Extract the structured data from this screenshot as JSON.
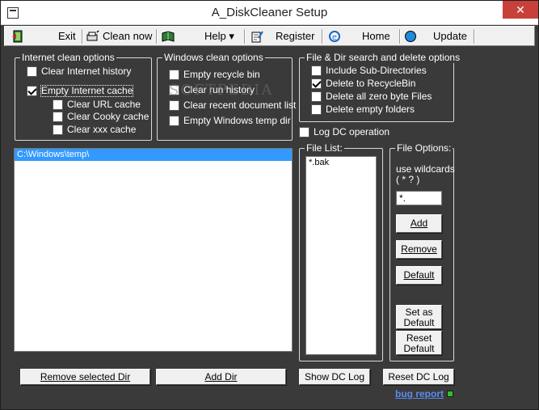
{
  "window": {
    "title": "A_DiskCleaner Setup",
    "close_glyph": "✕"
  },
  "menu": {
    "exit": "Exit",
    "clean_now": "Clean now",
    "help": "Help",
    "help_arrow": "▾",
    "register": "Register",
    "home": "Home",
    "update": "Update"
  },
  "internet": {
    "title": "Internet clean options",
    "clear_history": "Clear Internet history",
    "empty_cache": "Empty Internet cache",
    "clear_url": "Clear URL cache",
    "clear_cooky": "Clear Cooky cache",
    "clear_xxx": "Clear xxx cache"
  },
  "windows": {
    "title": "Windows clean options",
    "empty_recycle": "Empty recycle bin",
    "clear_run": "Clear run history",
    "clear_recent": "Clear recent document list",
    "empty_temp": "Empty Windows temp dir"
  },
  "filedir": {
    "title": "File & Dir search and delete options",
    "include_sub": "Include Sub-Directories",
    "delete_recycle": "Delete to RecycleBin",
    "delete_zero": "Delete all zero byte Files",
    "delete_empty": "Delete empty folders"
  },
  "log_dc": "Log DC operation",
  "dirs": [
    "C:\\Windows\\temp\\"
  ],
  "file_list": {
    "title": "File List:",
    "items": [
      "*.bak"
    ]
  },
  "file_options": {
    "title": "File Options:",
    "wildcard_line1": "use wildcards",
    "wildcard_line2": "( * ? )",
    "input_value": "*.",
    "add": "Add",
    "remove": "Remove",
    "default": "Default",
    "set_as_default_1": "Set as",
    "set_as_default_2": "Default",
    "reset_default_1": "Reset",
    "reset_default_2": "Default"
  },
  "bottom": {
    "remove_dir": "Remove selected Dir",
    "add_dir": "Add Dir",
    "show_log": "Show DC Log",
    "reset_log": "Reset DC Log",
    "bug_report": "bug report"
  },
  "watermark": "SOFTPEDIA"
}
